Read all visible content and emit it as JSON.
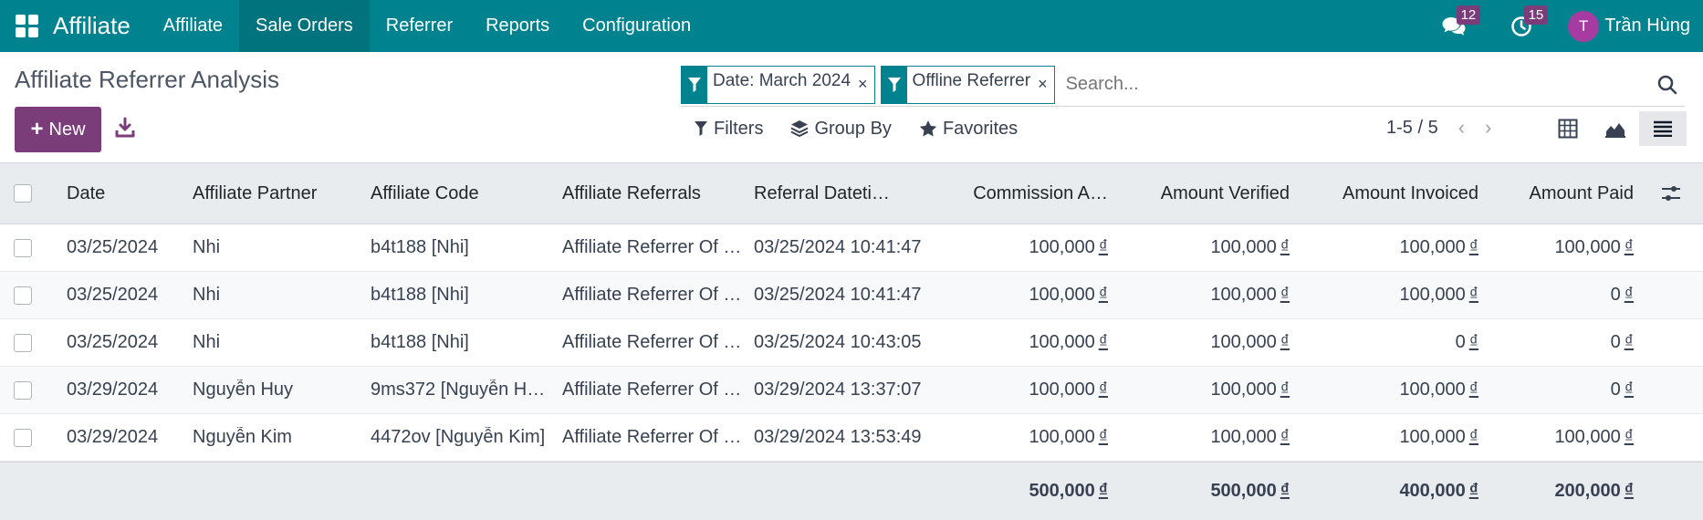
{
  "navbar": {
    "brand": "Affiliate",
    "menu": [
      "Affiliate",
      "Sale Orders",
      "Referrer",
      "Reports",
      "Configuration"
    ],
    "active_menu": "Sale Orders",
    "messages_count": "12",
    "activities_count": "15",
    "user_initial": "T",
    "user_name": "Trần Hùng"
  },
  "page": {
    "title": "Affiliate Referrer Analysis",
    "new_label": "New"
  },
  "search": {
    "facets": [
      "Date: March 2024",
      "Offline Referrer"
    ],
    "placeholder": "Search..."
  },
  "toolbar": {
    "filters": "Filters",
    "group_by": "Group By",
    "favorites": "Favorites"
  },
  "pager": {
    "text": "1-5 / 5"
  },
  "table": {
    "headers": [
      "Date",
      "Affiliate Partner",
      "Affiliate Code",
      "Affiliate Referrals",
      "Referral Dateti…",
      "Commission A…",
      "Amount Verified",
      "Amount Invoiced",
      "Amount Paid"
    ],
    "currency": "₫",
    "rows": [
      {
        "date": "03/25/2024",
        "partner": "Nhi",
        "code": "b4t188 [Nhi]",
        "referrals": "Affiliate Referrer Of …",
        "refdate": "03/25/2024 10:41:47",
        "commission": "100,000",
        "verified": "100,000",
        "invoiced": "100,000",
        "paid": "100,000"
      },
      {
        "date": "03/25/2024",
        "partner": "Nhi",
        "code": "b4t188 [Nhi]",
        "referrals": "Affiliate Referrer Of …",
        "refdate": "03/25/2024 10:41:47",
        "commission": "100,000",
        "verified": "100,000",
        "invoiced": "100,000",
        "paid": "0"
      },
      {
        "date": "03/25/2024",
        "partner": "Nhi",
        "code": "b4t188 [Nhi]",
        "referrals": "Affiliate Referrer Of …",
        "refdate": "03/25/2024 10:43:05",
        "commission": "100,000",
        "verified": "100,000",
        "invoiced": "0",
        "paid": "0"
      },
      {
        "date": "03/29/2024",
        "partner": "Nguyễn Huy",
        "code": "9ms372 [Nguyễn H…",
        "referrals": "Affiliate Referrer Of …",
        "refdate": "03/29/2024 13:37:07",
        "commission": "100,000",
        "verified": "100,000",
        "invoiced": "100,000",
        "paid": "0"
      },
      {
        "date": "03/29/2024",
        "partner": "Nguyễn Kim",
        "code": "4472ov [Nguyễn Kim]",
        "referrals": "Affiliate Referrer Of …",
        "refdate": "03/29/2024 13:53:49",
        "commission": "100,000",
        "verified": "100,000",
        "invoiced": "100,000",
        "paid": "100,000"
      }
    ],
    "totals": {
      "commission": "500,000",
      "verified": "500,000",
      "invoiced": "400,000",
      "paid": "200,000"
    }
  },
  "colors": {
    "navbar": "#00838f",
    "primary": "#7b3d7a",
    "avatar": "#a63ba1"
  }
}
